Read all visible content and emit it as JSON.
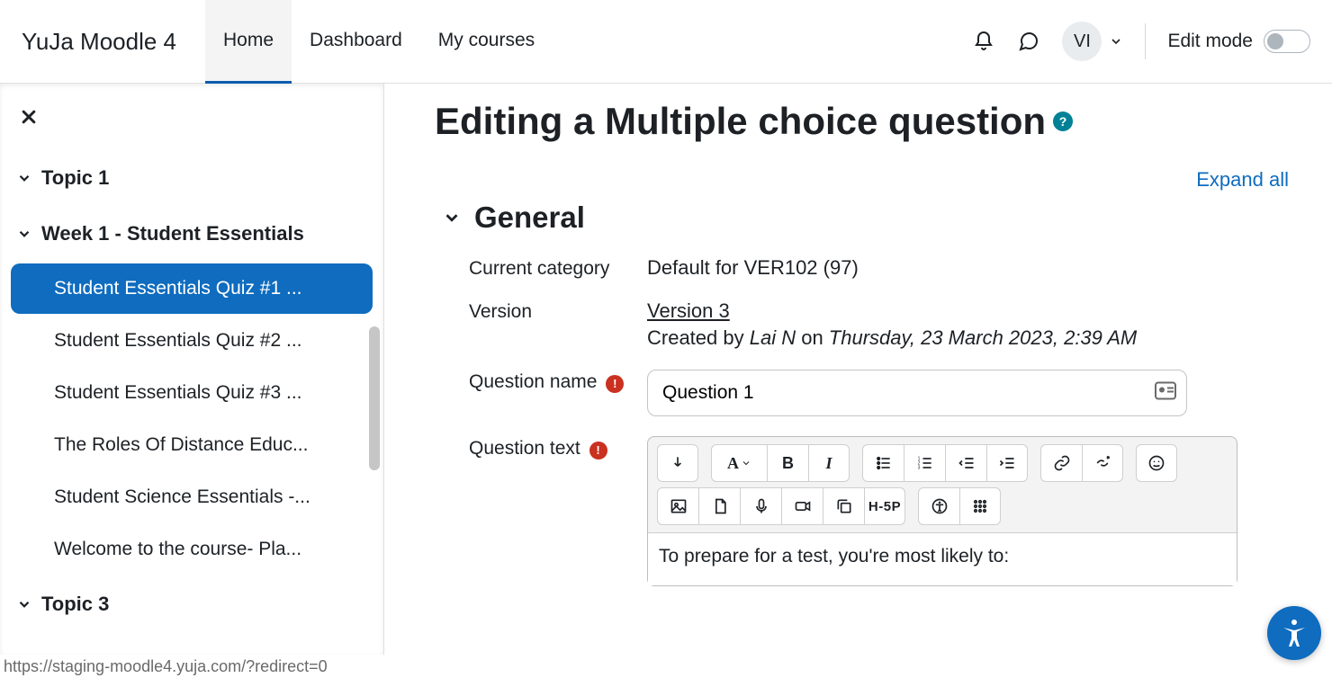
{
  "brand": "YuJa Moodle 4",
  "nav": {
    "home": "Home",
    "dashboard": "Dashboard",
    "mycourses": "My courses",
    "active": "home"
  },
  "header": {
    "avatar_initials": "VI",
    "edit_mode_label": "Edit mode"
  },
  "sidebar": {
    "sections": [
      {
        "label": "Topic 1",
        "items": []
      },
      {
        "label": "Week 1 - Student Essentials",
        "items": [
          {
            "label": "Student Essentials Quiz #1 ...",
            "active": true
          },
          {
            "label": "Student Essentials Quiz #2 ..."
          },
          {
            "label": "Student Essentials Quiz #3 ..."
          },
          {
            "label": "The Roles Of Distance Educ..."
          },
          {
            "label": "Student Science Essentials -..."
          },
          {
            "label": "Welcome to the course- Pla..."
          }
        ]
      },
      {
        "label": "Topic 3",
        "items": []
      }
    ]
  },
  "main": {
    "title": "Editing a Multiple choice question",
    "expand_all": "Expand all",
    "general_heading": "General",
    "current_category_label": "Current category",
    "current_category_value": "Default for VER102 (97)",
    "version_label": "Version",
    "version_value": "Version 3",
    "created_by_prefix": "Created by ",
    "created_by_name": "Lai N",
    "created_by_mid": " on ",
    "created_by_date": "Thursday, 23 March 2023, 2:39 AM",
    "question_name_label": "Question name",
    "question_name_value": "Question 1",
    "question_text_label": "Question text",
    "editor": {
      "content": "To prepare for a test, you're most likely to:",
      "h5p_label": "H-5P"
    }
  },
  "status_url": "https://staging-moodle4.yuja.com/?redirect=0"
}
